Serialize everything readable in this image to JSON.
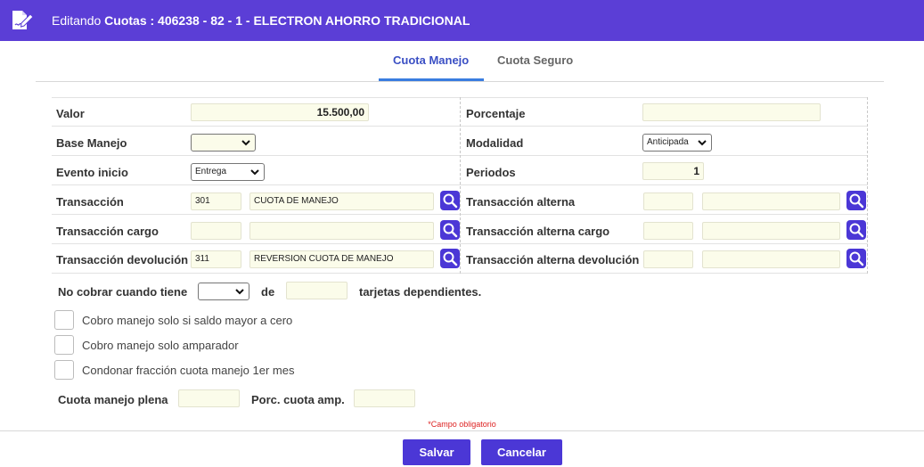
{
  "header": {
    "prefix": "Editando",
    "title": "Cuotas : 406238 - 82 - 1 - ELECTRON AHORRO TRADICIONAL",
    "icon": "edit-document-icon",
    "bg_color": "#5b3ed6"
  },
  "tabs": [
    {
      "label": "Cuota Manejo",
      "active": true
    },
    {
      "label": "Cuota Seguro",
      "active": false
    }
  ],
  "form": {
    "valor": {
      "label": "Valor",
      "value": "15.500,00"
    },
    "porcentaje": {
      "label": "Porcentaje",
      "value": ""
    },
    "base_manejo": {
      "label": "Base Manejo",
      "value": ""
    },
    "modalidad": {
      "label": "Modalidad",
      "value": "Anticipada"
    },
    "evento_inicio": {
      "label": "Evento inicio",
      "value": "Entrega"
    },
    "periodos": {
      "label": "Periodos",
      "value": "1"
    },
    "transaccion": {
      "label": "Transacción",
      "code": "301",
      "desc": "CUOTA DE MANEJO"
    },
    "transaccion_alterna": {
      "label": "Transacción alterna",
      "code": "",
      "desc": ""
    },
    "transaccion_cargo": {
      "label": "Transacción cargo",
      "code": "",
      "desc": ""
    },
    "transaccion_alterna_cargo": {
      "label": "Transacción alterna cargo",
      "code": "",
      "desc": ""
    },
    "transaccion_devolucion": {
      "label": "Transacción devolución",
      "code": "311",
      "desc": "REVERSION CUOTA DE MANEJO"
    },
    "transaccion_alterna_devolucion": {
      "label": "Transacción alterna devolución",
      "code": "",
      "desc": ""
    }
  },
  "no_cobrar": {
    "label": "No cobrar cuando tiene",
    "select_value": "",
    "de_label": "de",
    "count_value": "",
    "suffix": "tarjetas dependientes."
  },
  "checkboxes": [
    {
      "label": "Cobro manejo solo si saldo mayor a cero",
      "checked": false
    },
    {
      "label": "Cobro manejo solo amparador",
      "checked": false
    },
    {
      "label": "Condonar fracción cuota manejo 1er mes",
      "checked": false
    }
  ],
  "extra": {
    "cuota_plena": {
      "label": "Cuota manejo plena",
      "value": ""
    },
    "porc_cuota_amp": {
      "label": "Porc. cuota amp.",
      "value": ""
    }
  },
  "required_note": "*Campo obligatorio",
  "buttons": {
    "save": "Salvar",
    "cancel": "Cancelar"
  },
  "colors": {
    "accent": "#4b37d6",
    "tab_active": "#3a4fc4",
    "tab_underline": "#3a7de0",
    "input_bg": "#fbfcea",
    "required": "#dd2222"
  }
}
